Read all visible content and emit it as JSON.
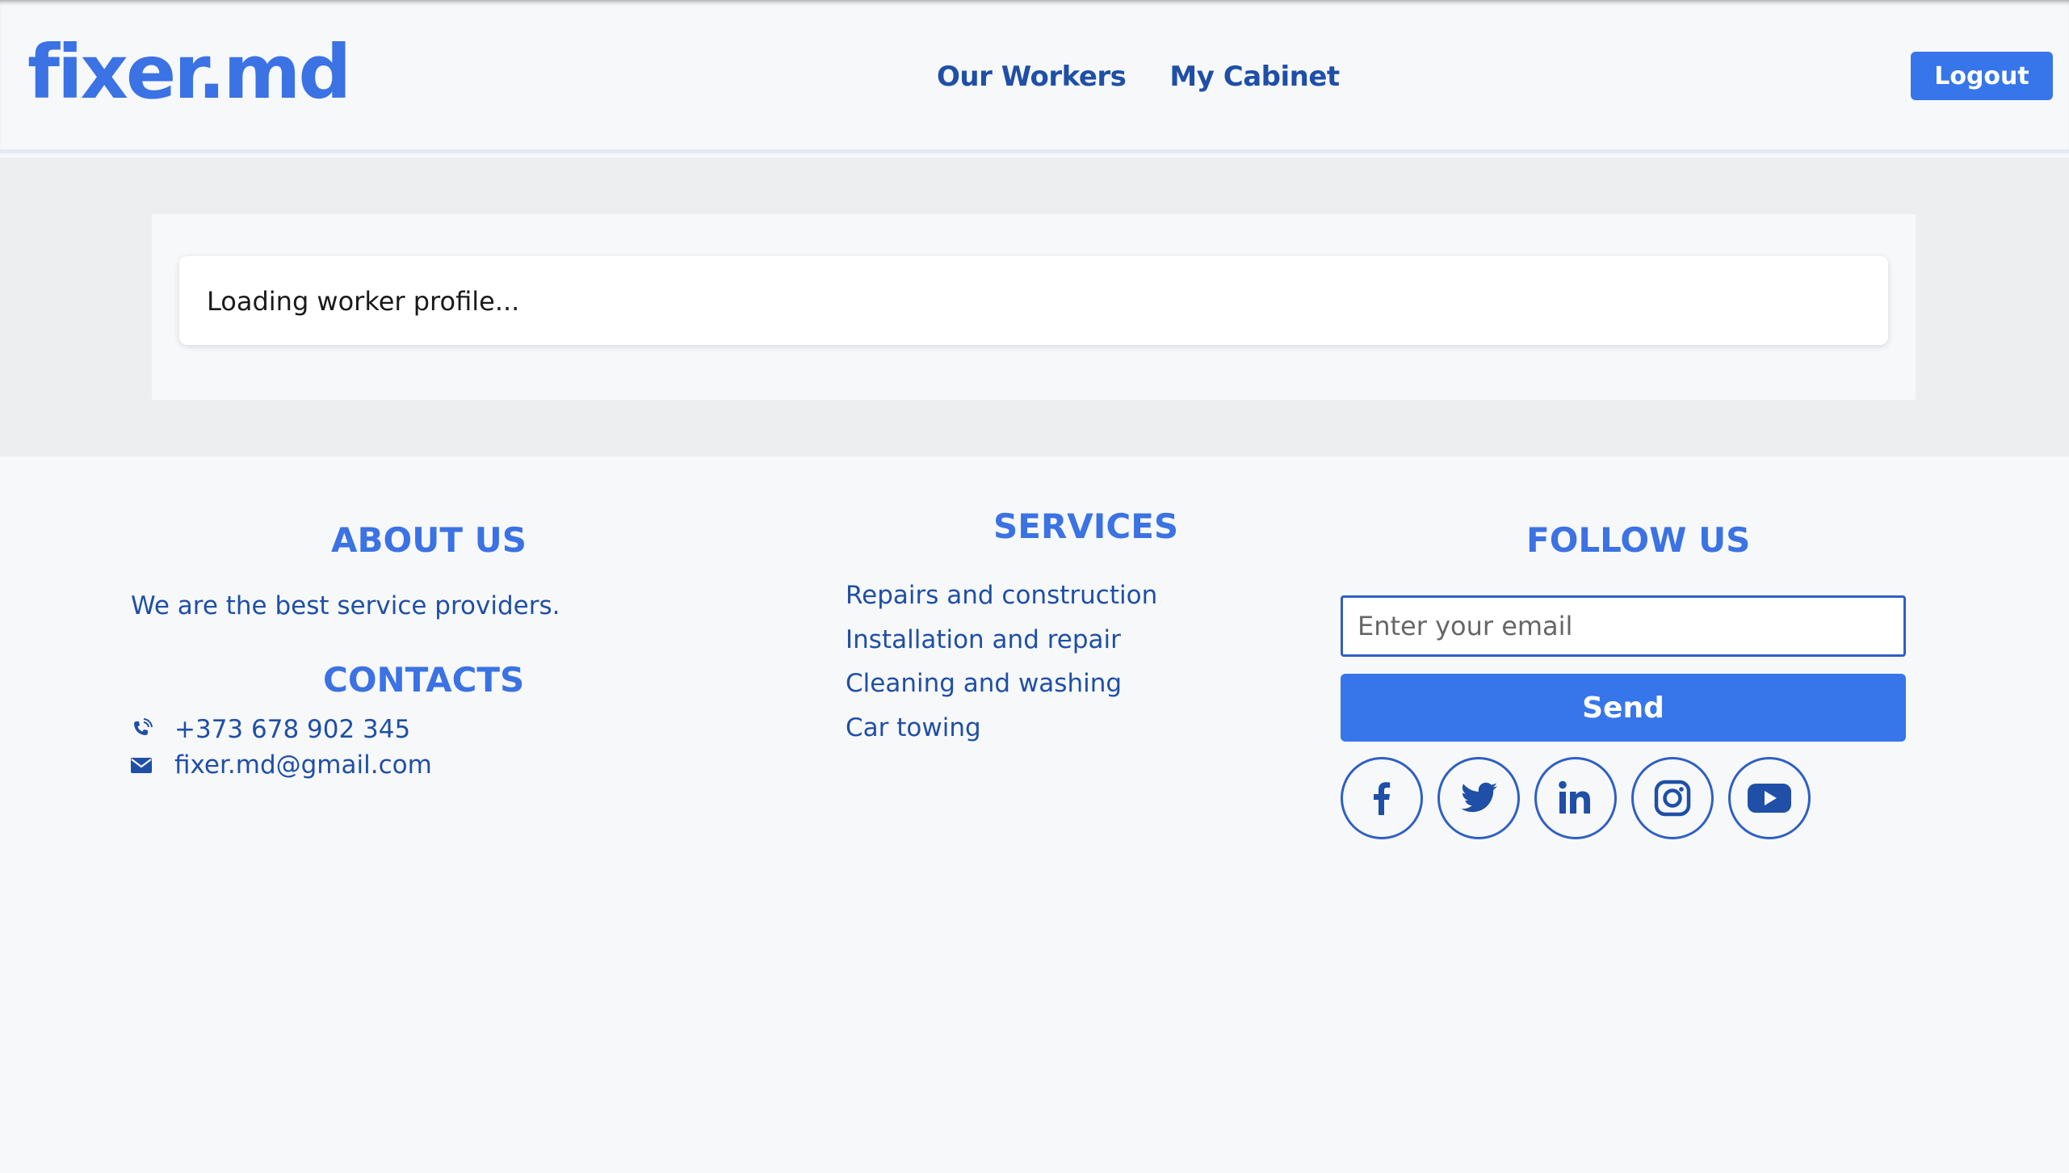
{
  "header": {
    "logo": "fixer.md",
    "nav": [
      "Our Workers",
      "My Cabinet"
    ],
    "logout_label": "Logout"
  },
  "main": {
    "status_text": "Loading worker profile..."
  },
  "footer": {
    "about": {
      "heading": "ABOUT US",
      "text": "We are the best service providers."
    },
    "contacts": {
      "heading": "CONTACTS",
      "phone": "+373 678 902 345",
      "email": "fixer.md@gmail.com",
      "phone_icon": "phone-icon",
      "email_icon": "envelope-icon"
    },
    "services": {
      "heading": "SERVICES",
      "items": [
        "Repairs and construction",
        "Installation and repair",
        "Cleaning and washing",
        "Car towing"
      ]
    },
    "follow": {
      "heading": "FOLLOW US",
      "email_placeholder": "Enter your email",
      "send_label": "Send",
      "socials": [
        "facebook-icon",
        "twitter-icon",
        "linkedin-icon",
        "instagram-icon",
        "youtube-icon"
      ]
    }
  },
  "colors": {
    "brand": "#3b72e4",
    "button": "#3776ea",
    "text_dark_blue": "#1f4fa6"
  }
}
